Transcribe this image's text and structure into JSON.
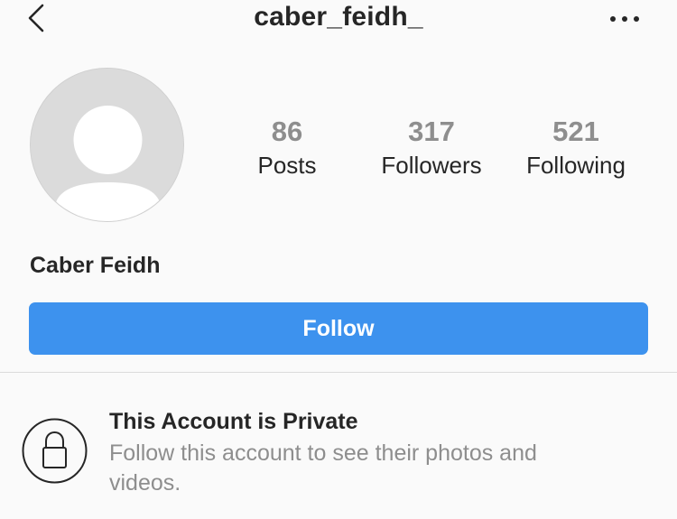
{
  "header": {
    "username": "caber_feidh_",
    "back_icon": "chevron-left-icon",
    "more_icon": "more-horizontal-icon"
  },
  "profile": {
    "avatar_icon": "default-avatar-icon",
    "full_name": "Caber Feidh"
  },
  "stats": [
    {
      "value": "86",
      "label": "Posts"
    },
    {
      "value": "317",
      "label": "Followers"
    },
    {
      "value": "521",
      "label": "Following"
    }
  ],
  "actions": {
    "follow_label": "Follow"
  },
  "private_notice": {
    "icon": "lock-icon",
    "title": "This Account is Private",
    "description": "Follow this account to see their photos and videos."
  },
  "colors": {
    "accent": "#3d92ee",
    "text": "#262626",
    "muted": "#8e8e8e",
    "background": "#fafafa"
  }
}
